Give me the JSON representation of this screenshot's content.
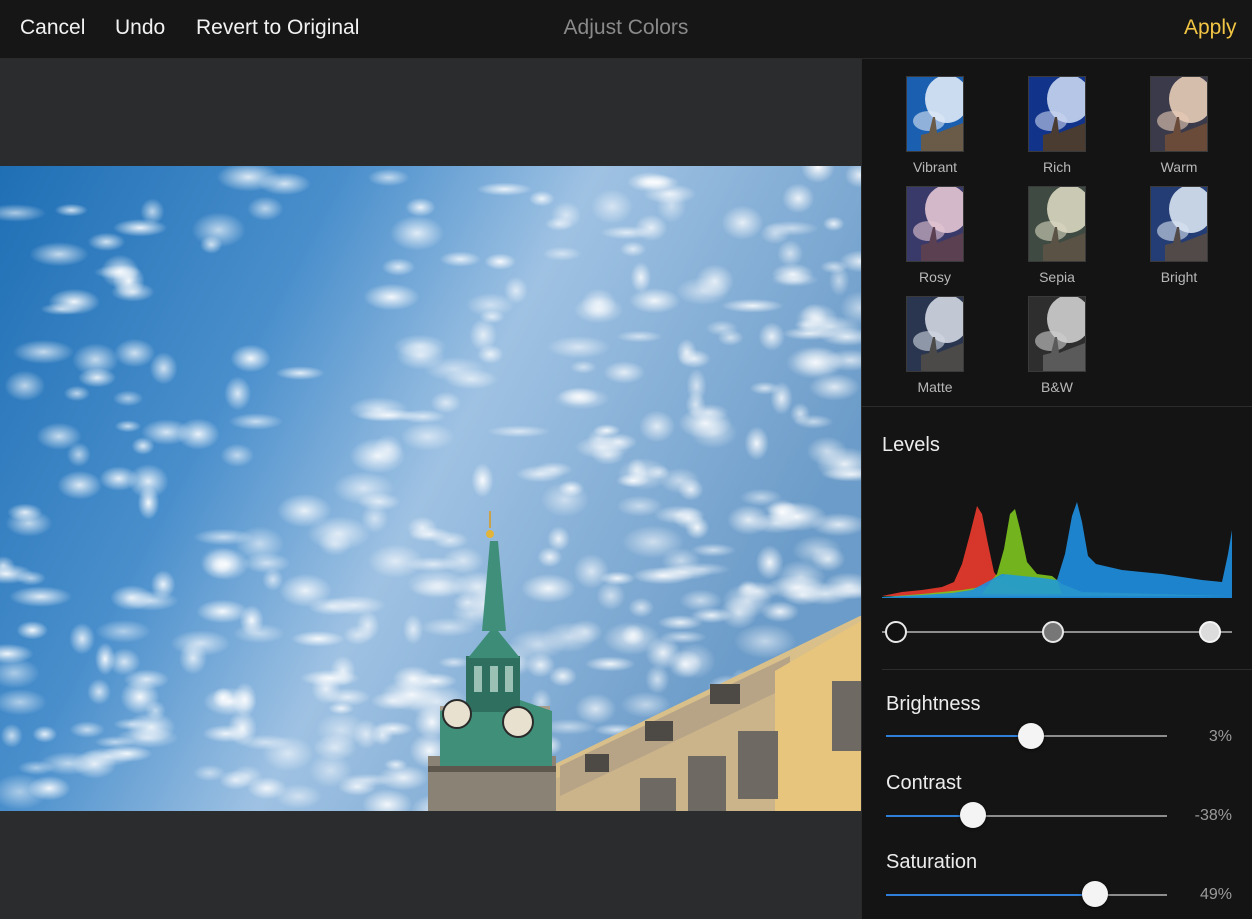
{
  "toolbar": {
    "cancel_label": "Cancel",
    "undo_label": "Undo",
    "revert_label": "Revert to Original",
    "title": "Adjust Colors",
    "apply_label": "Apply"
  },
  "presets": [
    {
      "label": "Vibrant"
    },
    {
      "label": "Rich"
    },
    {
      "label": "Warm"
    },
    {
      "label": "Rosy"
    },
    {
      "label": "Sepia"
    },
    {
      "label": "Bright"
    },
    {
      "label": "Matte"
    },
    {
      "label": "B&W"
    }
  ],
  "levels": {
    "title": "Levels",
    "black_point": 0.0,
    "mid_point": 0.5,
    "white_point": 1.0
  },
  "adjustments": [
    {
      "label": "Brightness",
      "value_text": "3%",
      "level": 0.515
    },
    {
      "label": "Contrast",
      "value_text": "-38%",
      "level": 0.31
    },
    {
      "label": "Saturation",
      "value_text": "49%",
      "level": 0.745
    }
  ],
  "colors": {
    "accent": "#f2c544",
    "slider_fill": "#2f7fd8",
    "histogram_red": "#e0392b",
    "histogram_green": "#7cc11f",
    "histogram_blue": "#1e8fe0"
  }
}
